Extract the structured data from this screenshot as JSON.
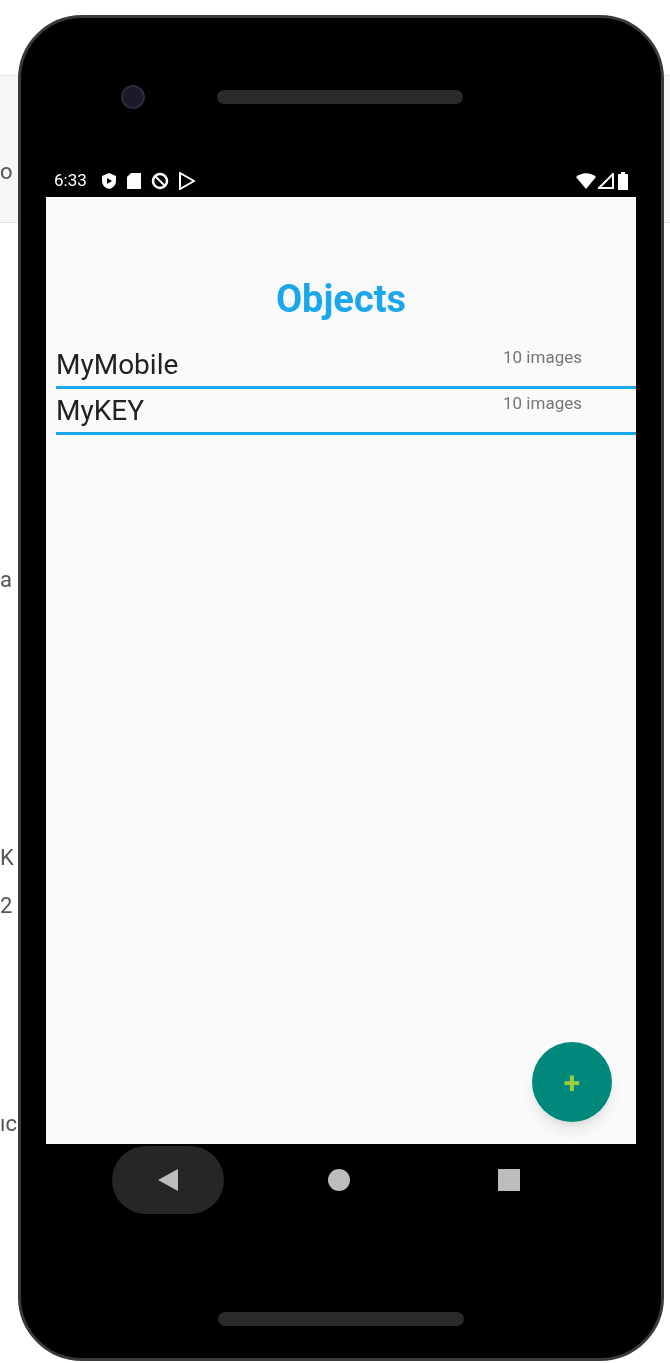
{
  "background_fragments": [
    "o",
    "a",
    "K",
    "2",
    "ıc"
  ],
  "status_bar": {
    "time": "6:33"
  },
  "screen": {
    "title": "Objects",
    "items": [
      {
        "name": "MyMobile",
        "count": "10 images"
      },
      {
        "name": "MyKEY",
        "count": "10 images"
      }
    ],
    "fab": {
      "label": "+"
    }
  }
}
